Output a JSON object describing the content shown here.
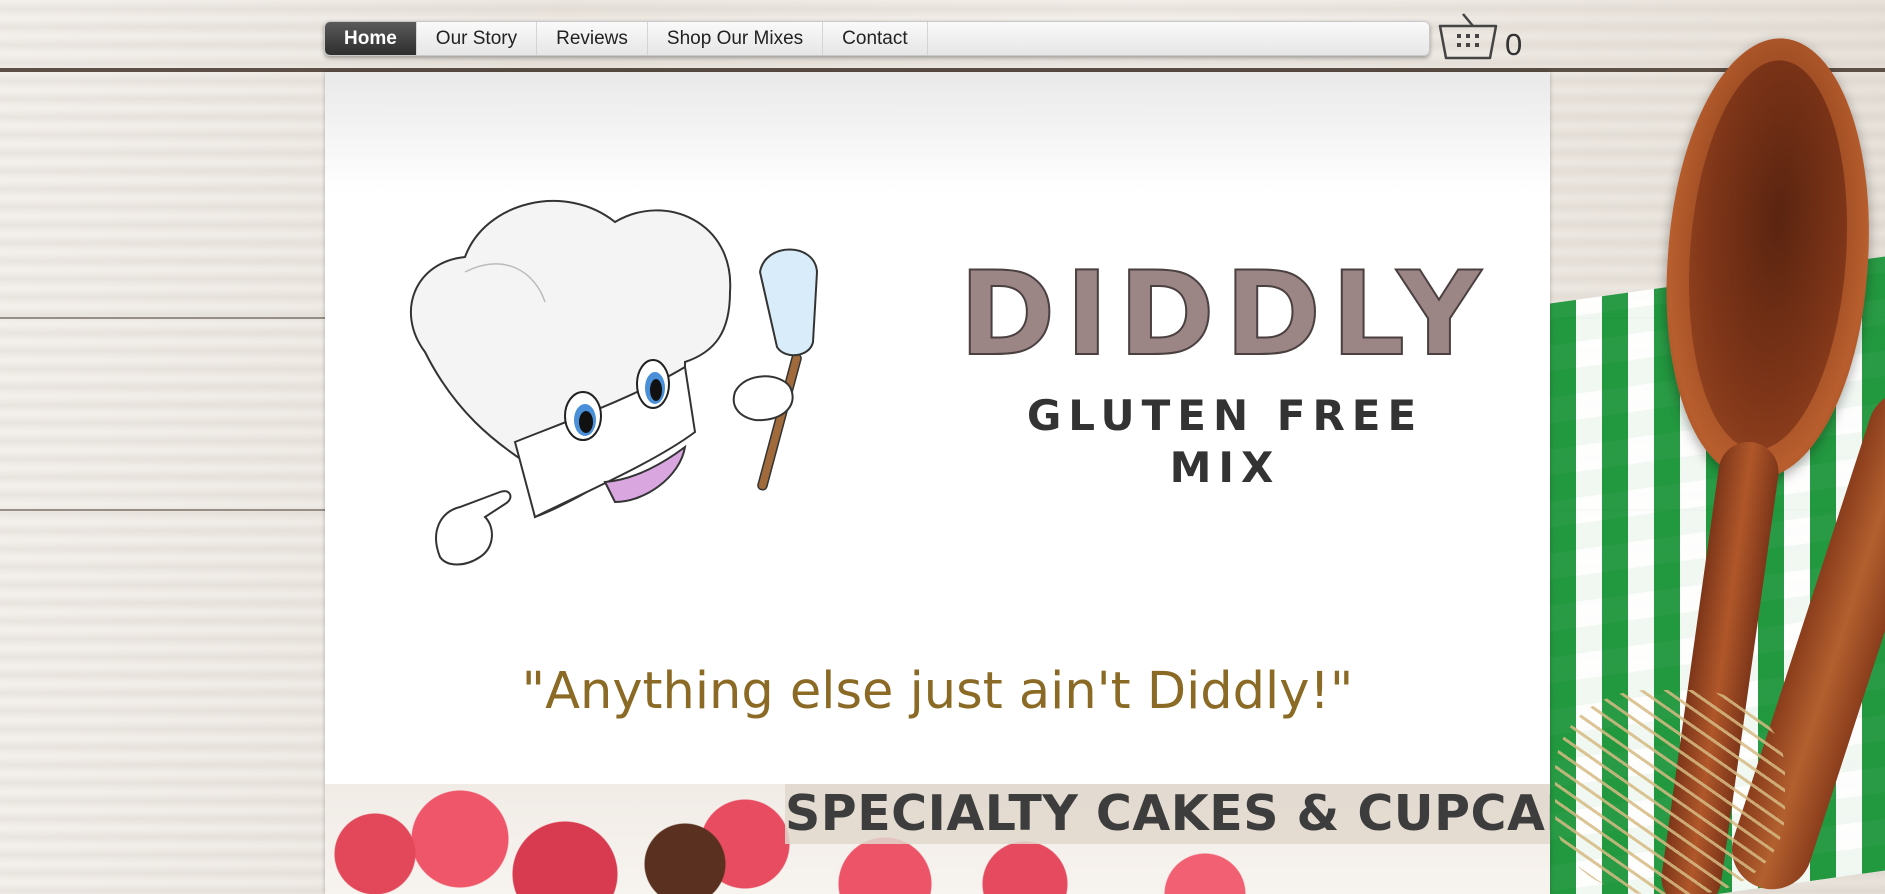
{
  "nav": {
    "items": [
      {
        "label": "Home",
        "active": true
      },
      {
        "label": "Our Story",
        "active": false
      },
      {
        "label": "Reviews",
        "active": false
      },
      {
        "label": "Shop Our Mixes",
        "active": false
      },
      {
        "label": "Contact",
        "active": false
      }
    ]
  },
  "cart": {
    "icon": "basket-icon",
    "count": "0"
  },
  "hero": {
    "brand_title": "DIDDLY",
    "brand_subtitle": "GLUTEN FREE MIX",
    "mascot_icon": "chef-hat-mascot-icon",
    "tagline": "\"Anything else just ain't Diddly!\""
  },
  "promo": {
    "heading": "SPECIALTY CAKES & CUPCAKES"
  },
  "colors": {
    "brand_title": "#9c8585",
    "tagline": "#8a6a25",
    "nav_active": "#2e2e2e"
  }
}
